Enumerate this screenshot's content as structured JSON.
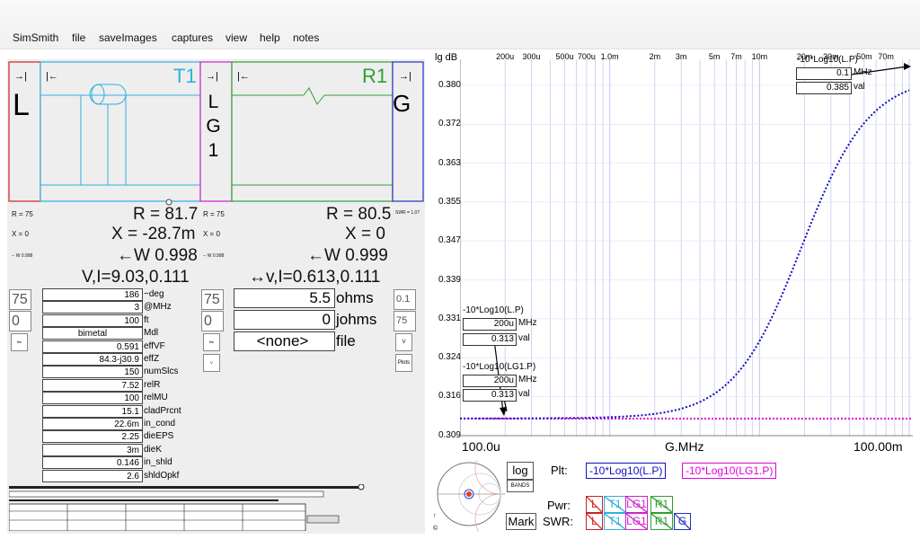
{
  "menu": [
    "SimSmith",
    "file",
    "saveImages",
    "captures",
    "view",
    "help",
    "notes"
  ],
  "load": {
    "letter": "L",
    "r": "R = 75",
    "x": "X = 0"
  },
  "t1": {
    "label": "T1",
    "r": "R = 81.7",
    "x": "X = -28.7m",
    "w": "←W 0.998",
    "vi": "V,I=9.03,0.111",
    "spin1": "75",
    "spin2": "0",
    "rows": [
      {
        "v": "186",
        "l": "~deg"
      },
      {
        "v": "3",
        "l": "@MHz"
      },
      {
        "v": "100",
        "l": "ft"
      },
      {
        "v": "bimetal",
        "l": "Mdl"
      },
      {
        "v": "0.591",
        "l": "effVF"
      },
      {
        "v": "84.3-j30.9",
        "l": "effZ"
      },
      {
        "v": "150",
        "l": "numSlcs"
      },
      {
        "v": "7.52",
        "l": "relR"
      },
      {
        "v": "100",
        "l": "relMU"
      },
      {
        "v": "15.1",
        "l": "cladPrcnt"
      },
      {
        "v": "22.6m",
        "l": "in_cond"
      },
      {
        "v": "2.25",
        "l": "dieEPS"
      },
      {
        "v": "3m",
        "l": "dieK"
      },
      {
        "v": "0.146",
        "l": "in_shld"
      },
      {
        "v": "2.6",
        "l": "shldOpkf"
      }
    ]
  },
  "lg1": {
    "letters": [
      "L",
      "G",
      "1"
    ],
    "r": "R = 75",
    "x": "X = 0"
  },
  "r1": {
    "label": "R1",
    "r": "R = 80.5",
    "x": "X = 0",
    "w": "←W 0.999",
    "vi": "↔v,I=0.613,0.111",
    "spin1": "75",
    "spin2": "0",
    "fields": [
      {
        "v": "5.5",
        "l": "ohms"
      },
      {
        "v": "0",
        "l": "johms"
      },
      {
        "v": "<none>",
        "l": "file"
      }
    ]
  },
  "gen": {
    "letter": "G",
    "spin1": "0.1",
    "spin2": "75",
    "small_v": "V",
    "plots": "Plots"
  },
  "graph": {
    "ylabel": "lg dB",
    "yticks": [
      "0.380",
      "0.372",
      "0.363",
      "0.355",
      "0.347",
      "0.339",
      "0.331",
      "0.324",
      "0.316",
      "0.309"
    ],
    "xticks": [
      "200u",
      "300u",
      "500u",
      "700u",
      "1.0m",
      "2m",
      "3m",
      "5m",
      "7m",
      "10m",
      "20m",
      "30m",
      "50m",
      "70m"
    ],
    "x_start": "100.0u",
    "x_mid": "G.MHz",
    "x_end": "100.00m",
    "marker_left": {
      "t1": "-10*Log10(L.P)",
      "mhz1": "200u",
      "val1": "0.313",
      "t2": "-10*Log10(LG1.P)",
      "mhz2": "200u",
      "val2": "0.313"
    },
    "marker_right": {
      "title": "-10*Log10(L.P)",
      "mhz": "0.1",
      "val": "0.385"
    },
    "unit_mhz": "MHz",
    "unit_val": "val",
    "colors": {
      "lp": "#1010c0",
      "lg1p": "#e000e0",
      "grid": "#c8c8f0"
    }
  },
  "controls": {
    "log_btn": "log",
    "bands_btn": "BANDS",
    "mark_btn": "Mark",
    "plt_label": "Plt:",
    "plt1": "-10*Log10(L.P)",
    "plt2": "-10*Log10(LG1.P)",
    "pwr_label": "Pwr:",
    "swr_label": "SWR:",
    "pwr_items": [
      "L",
      "T1",
      "LG1",
      "R1"
    ],
    "swr_items": [
      "L",
      "T1",
      "LG1",
      "R1",
      "G"
    ]
  }
}
